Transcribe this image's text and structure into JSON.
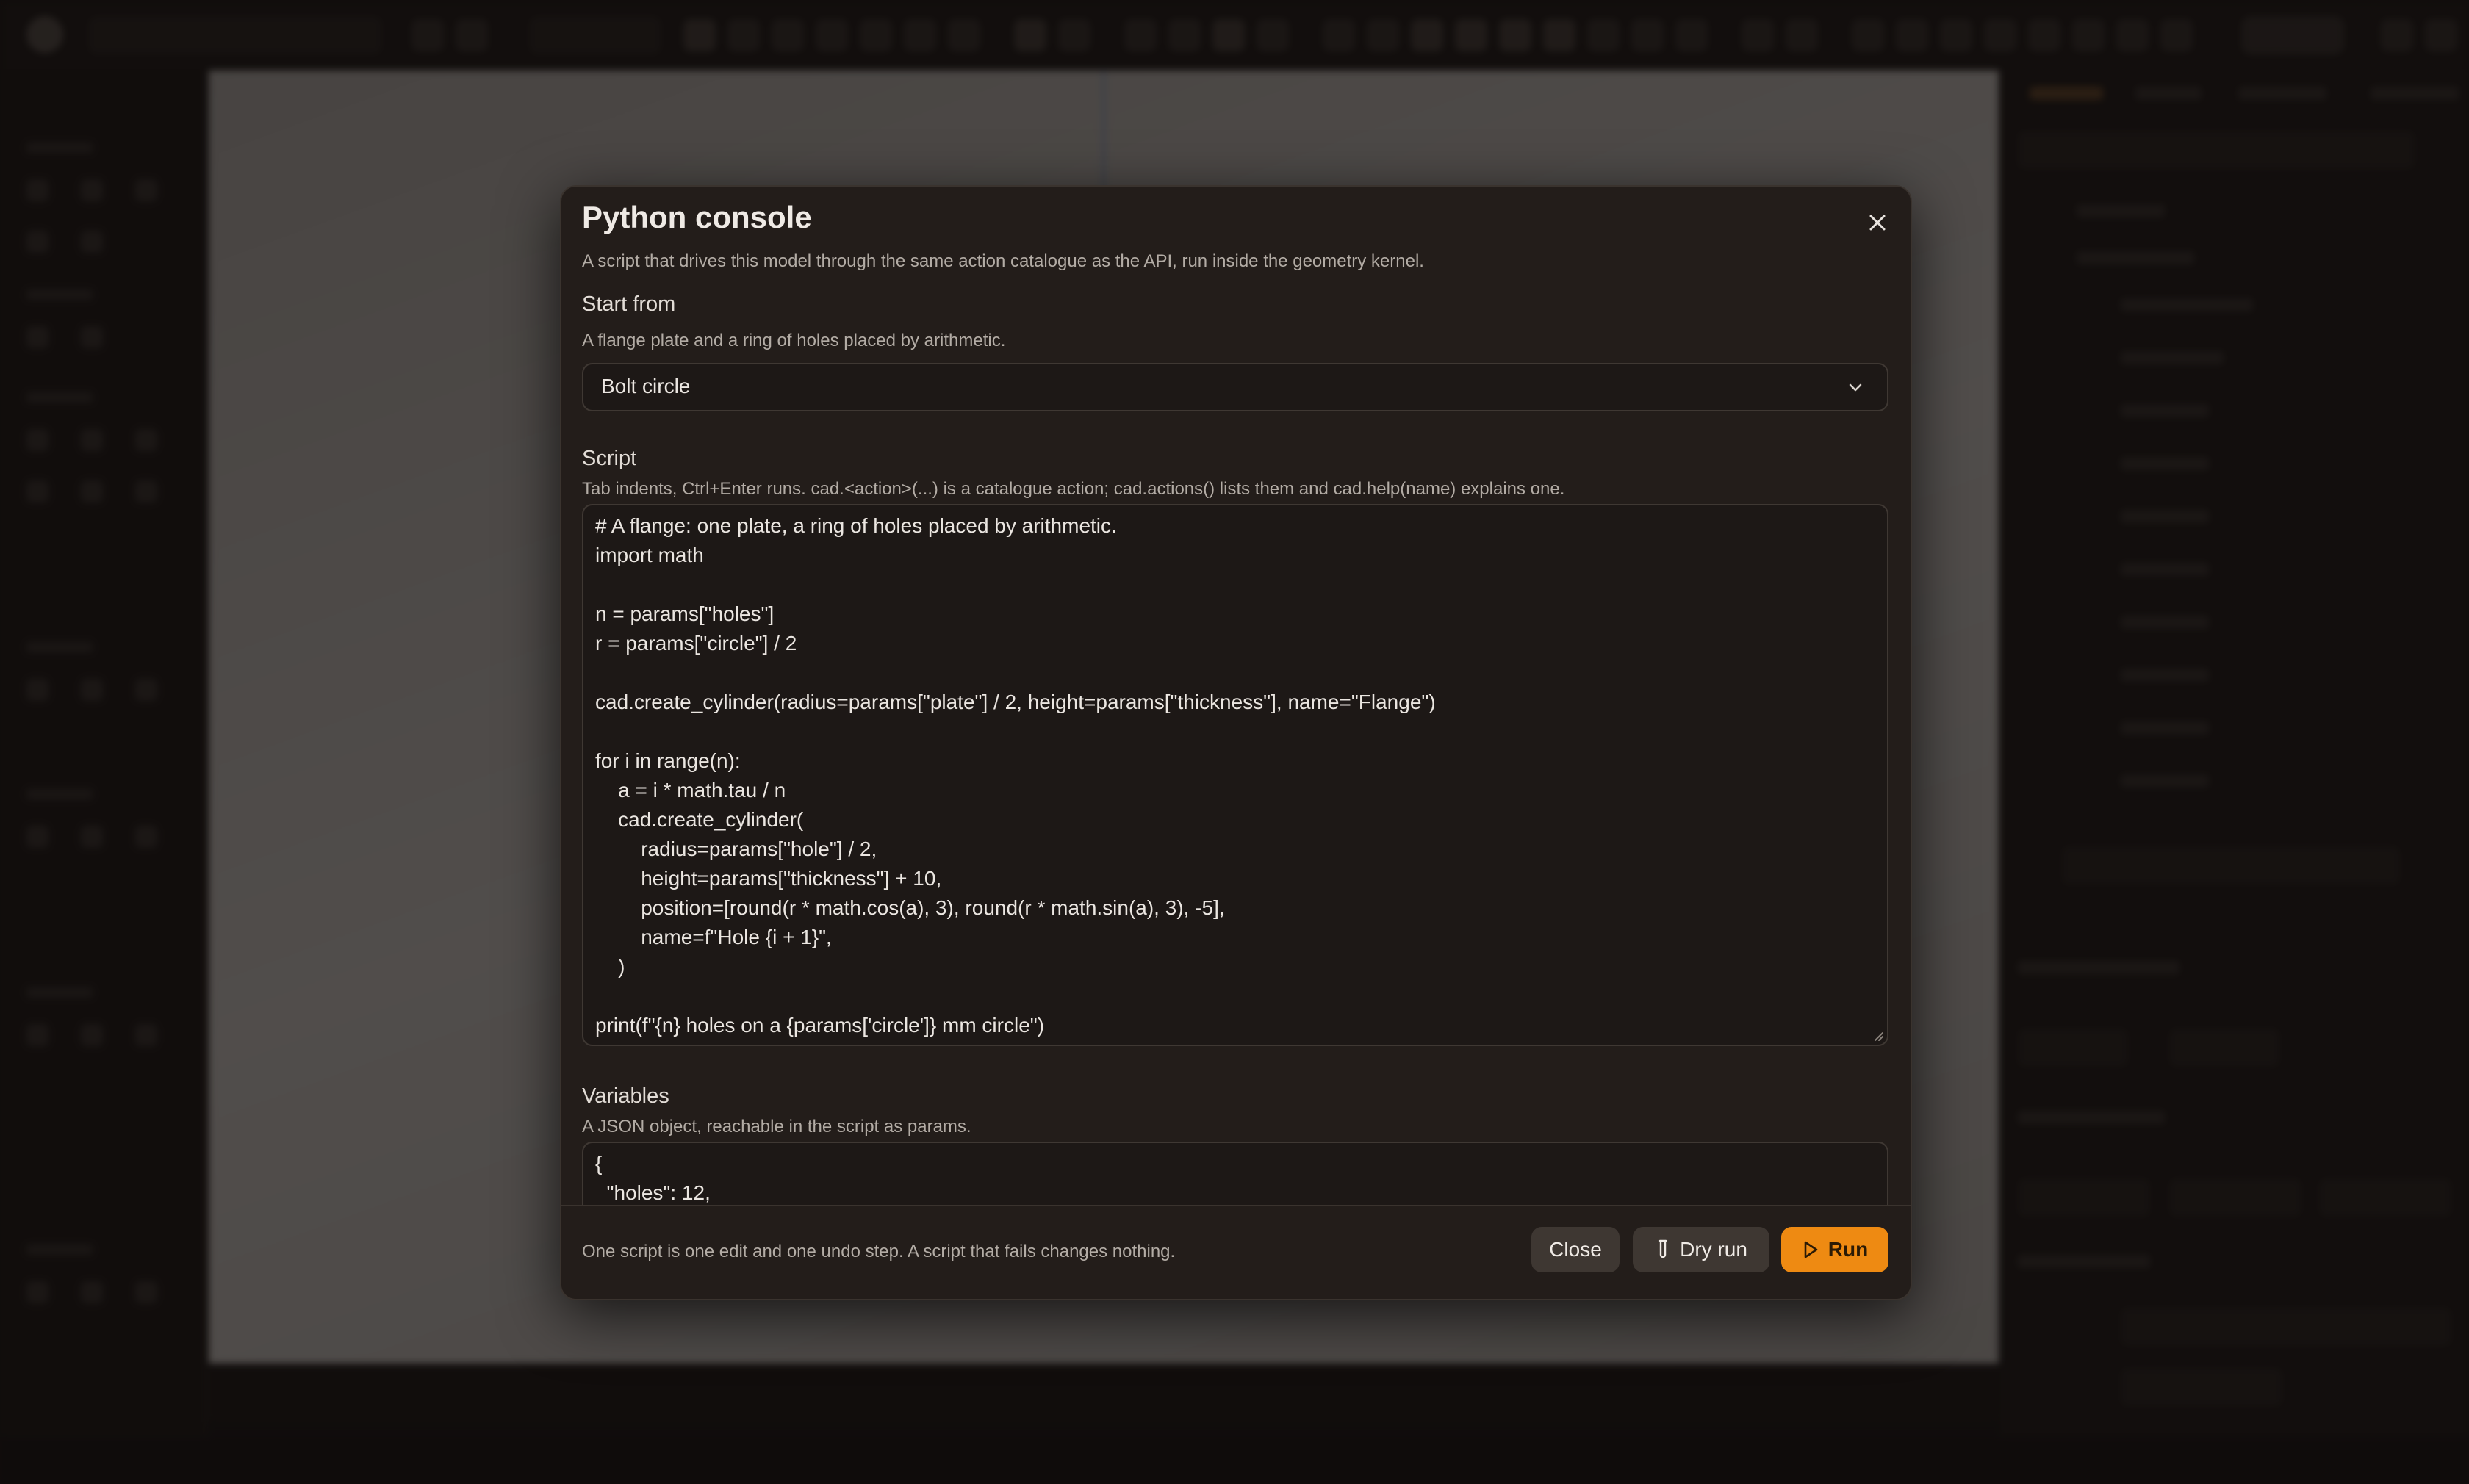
{
  "modal": {
    "title": "Python console",
    "subtitle": "A script that drives this model through the same action catalogue as the API, run inside the geometry kernel.",
    "start_from": {
      "label": "Start from",
      "description": "A flange plate and a ring of holes placed by arithmetic.",
      "selected": "Bolt circle"
    },
    "script": {
      "label": "Script",
      "description": "Tab indents, Ctrl+Enter runs. cad.<action>(...) is a catalogue action; cad.actions() lists them and cad.help(name) explains one.",
      "code": "# A flange: one plate, a ring of holes placed by arithmetic.\nimport math\n\nn = params[\"holes\"]\nr = params[\"circle\"] / 2\n\ncad.create_cylinder(radius=params[\"plate\"] / 2, height=params[\"thickness\"], name=\"Flange\")\n\nfor i in range(n):\n    a = i * math.tau / n\n    cad.create_cylinder(\n        radius=params[\"hole\"] / 2,\n        height=params[\"thickness\"] + 10,\n        position=[round(r * math.cos(a), 3), round(r * math.sin(a), 3), -5],\n        name=f\"Hole {i + 1}\",\n    )\n\nprint(f\"{n} holes on a {params['circle']} mm circle\")"
    },
    "variables": {
      "label": "Variables",
      "description": "A JSON object, reachable in the script as params.",
      "code": "{\n  \"holes\": 12,"
    },
    "footer": {
      "note": "One script is one edit and one undo step. A script that fails changes nothing.",
      "close_label": "Close",
      "dry_run_label": "Dry run",
      "run_label": "Run"
    }
  },
  "colors": {
    "accent": "#ee8a12",
    "modal_bg": "#231d1a"
  }
}
